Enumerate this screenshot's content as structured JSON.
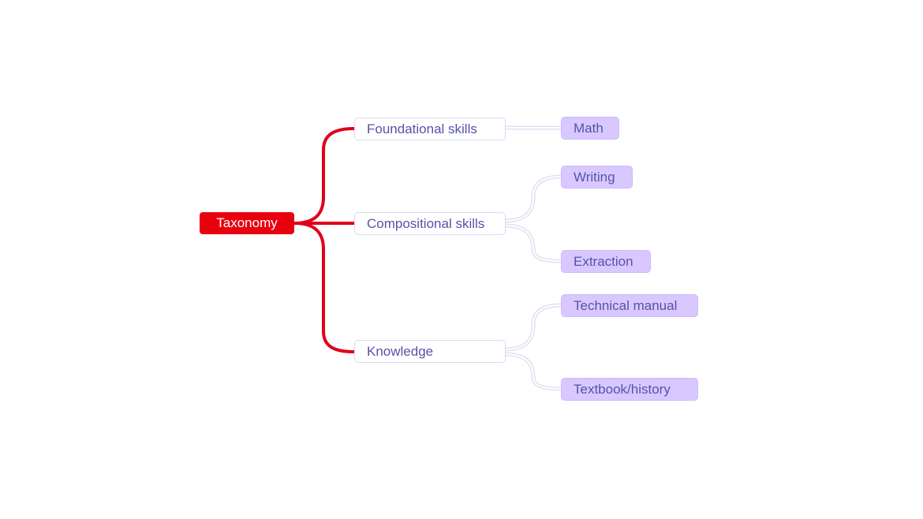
{
  "diagram": {
    "root": {
      "label": "Taxonomy"
    },
    "branches": [
      {
        "label": "Foundational skills",
        "children": [
          {
            "label": "Math"
          }
        ]
      },
      {
        "label": "Compositional skills",
        "children": [
          {
            "label": "Writing"
          },
          {
            "label": "Extraction"
          }
        ]
      },
      {
        "label": "Knowledge",
        "children": [
          {
            "label": "Technical manual"
          },
          {
            "label": "Textbook/history"
          }
        ]
      }
    ],
    "colors": {
      "root_fill": "#e8000f",
      "root_link": "#e0001b",
      "branch_text": "#5553a9",
      "leaf_fill": "#d9c8ff",
      "leaf_link": "#e2e0f4"
    }
  }
}
